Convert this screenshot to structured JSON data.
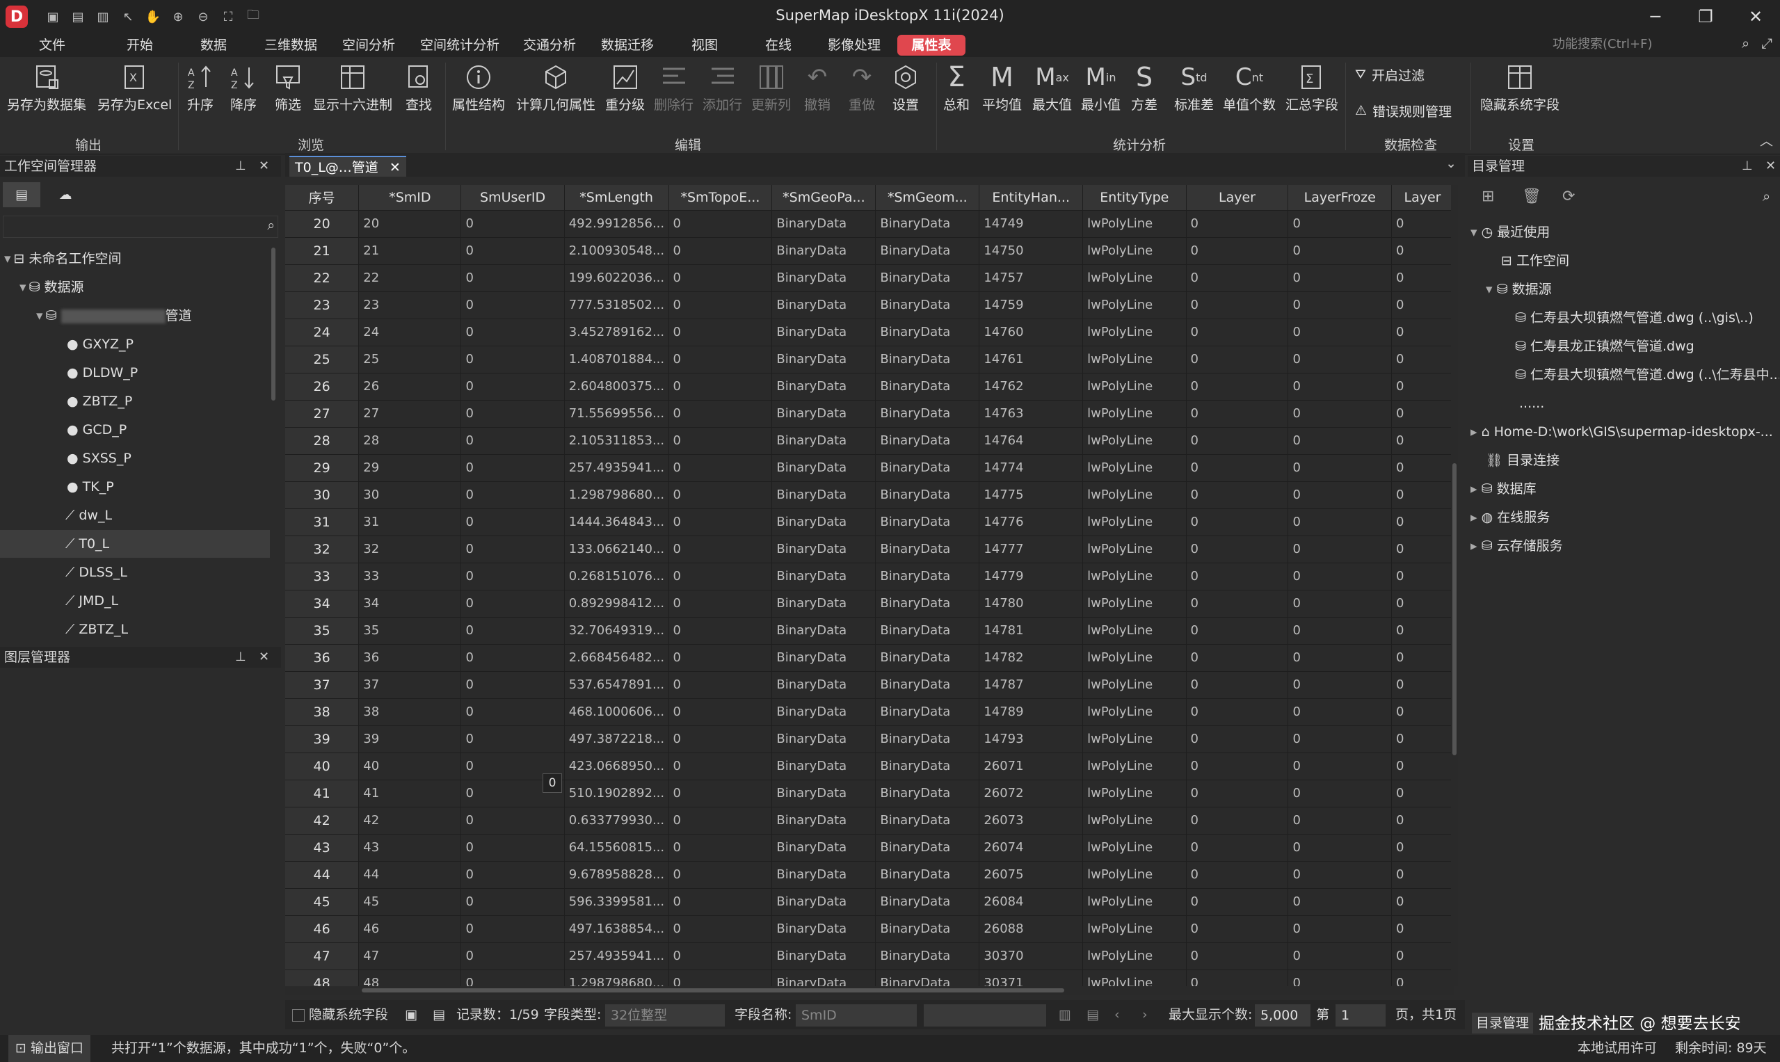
{
  "app_title": "SuperMap iDesktopX 11i(2024)",
  "menus": [
    "文件",
    "开始",
    "数据",
    "三维数据",
    "空间分析",
    "空间统计分析",
    "交通分析",
    "数据迁移",
    "视图",
    "在线",
    "影像处理",
    "属性表"
  ],
  "search_placeholder": "功能搜索(Ctrl+F)",
  "ribbon": {
    "buttons": [
      {
        "label": "另存为数据集",
        "icon": "save-as-dataset-icon"
      },
      {
        "label": "另存为Excel",
        "icon": "excel-icon"
      },
      {
        "label": "升序",
        "icon": "sort-asc-icon"
      },
      {
        "label": "降序",
        "icon": "sort-desc-icon"
      },
      {
        "label": "筛选",
        "icon": "filter-icon"
      },
      {
        "label": "显示十六进制",
        "icon": "hex-icon"
      },
      {
        "label": "查找",
        "icon": "find-icon"
      },
      {
        "label": "属性结构",
        "icon": "info-icon"
      },
      {
        "label": "计算几何属性",
        "icon": "geometry-icon"
      },
      {
        "label": "重分级",
        "icon": "reclass-icon"
      },
      {
        "label": "删除行",
        "icon": "delete-row-icon"
      },
      {
        "label": "添加行",
        "icon": "add-row-icon"
      },
      {
        "label": "更新列",
        "icon": "update-column-icon"
      },
      {
        "label": "撤销",
        "icon": "undo-icon"
      },
      {
        "label": "重做",
        "icon": "redo-icon"
      },
      {
        "label": "设置",
        "icon": "settings-icon"
      },
      {
        "label": "总和",
        "icon": "sum-icon"
      },
      {
        "label": "平均值",
        "icon": "mean-icon"
      },
      {
        "label": "最大值",
        "icon": "max-icon"
      },
      {
        "label": "最小值",
        "icon": "min-icon"
      },
      {
        "label": "方差",
        "icon": "variance-icon"
      },
      {
        "label": "标准差",
        "icon": "std-icon"
      },
      {
        "label": "单值个数",
        "icon": "count-icon"
      },
      {
        "label": "汇总字段",
        "icon": "summary-icon"
      },
      {
        "label": "隐藏系统字段",
        "icon": "hide-fields-icon"
      }
    ],
    "small_buttons": [
      "开启过滤",
      "错误规则管理"
    ],
    "groups": [
      "输出",
      "浏览",
      "编辑",
      "统计分析",
      "数据检查",
      "设置"
    ]
  },
  "workspace_panel": {
    "title": "工作空间管理器",
    "tree": [
      {
        "label": "未命名工作空间"
      },
      {
        "label": "数据源"
      },
      {
        "label": "管道"
      },
      {
        "label": "GXYZ_P"
      },
      {
        "label": "DLDW_P"
      },
      {
        "label": "ZBTZ_P"
      },
      {
        "label": "GCD_P"
      },
      {
        "label": "SXSS_P"
      },
      {
        "label": "TK_P"
      },
      {
        "label": "dw_L"
      },
      {
        "label": "T0_L"
      },
      {
        "label": "DLSS_L"
      },
      {
        "label": "JMD_L"
      },
      {
        "label": "ZBTZ_L"
      }
    ]
  },
  "layer_panel": {
    "title": "图层管理器"
  },
  "tab": {
    "label": "T0_L@…管道"
  },
  "columns": [
    "序号",
    "*SmID",
    "SmUserID",
    "*SmLength",
    "*SmTopoE...",
    "*SmGeoPa...",
    "*SmGeom...",
    "EntityHan...",
    "EntityType",
    "Layer",
    "LayerFroze",
    "Layer"
  ],
  "rows": [
    [
      "20",
      "20",
      "0",
      "492.9912856...",
      "0",
      "BinaryData",
      "BinaryData",
      "14749",
      "lwPolyLine",
      "0",
      "0",
      "0"
    ],
    [
      "21",
      "21",
      "0",
      "2.100930548...",
      "0",
      "BinaryData",
      "BinaryData",
      "14750",
      "lwPolyLine",
      "0",
      "0",
      "0"
    ],
    [
      "22",
      "22",
      "0",
      "199.6022036...",
      "0",
      "BinaryData",
      "BinaryData",
      "14757",
      "lwPolyLine",
      "0",
      "0",
      "0"
    ],
    [
      "23",
      "23",
      "0",
      "777.5318502...",
      "0",
      "BinaryData",
      "BinaryData",
      "14759",
      "lwPolyLine",
      "0",
      "0",
      "0"
    ],
    [
      "24",
      "24",
      "0",
      "3.452789162...",
      "0",
      "BinaryData",
      "BinaryData",
      "14760",
      "lwPolyLine",
      "0",
      "0",
      "0"
    ],
    [
      "25",
      "25",
      "0",
      "1.408701884...",
      "0",
      "BinaryData",
      "BinaryData",
      "14761",
      "lwPolyLine",
      "0",
      "0",
      "0"
    ],
    [
      "26",
      "26",
      "0",
      "2.604800375...",
      "0",
      "BinaryData",
      "BinaryData",
      "14762",
      "lwPolyLine",
      "0",
      "0",
      "0"
    ],
    [
      "27",
      "27",
      "0",
      "71.55699556...",
      "0",
      "BinaryData",
      "BinaryData",
      "14763",
      "lwPolyLine",
      "0",
      "0",
      "0"
    ],
    [
      "28",
      "28",
      "0",
      "2.105311853...",
      "0",
      "BinaryData",
      "BinaryData",
      "14764",
      "lwPolyLine",
      "0",
      "0",
      "0"
    ],
    [
      "29",
      "29",
      "0",
      "257.4935941...",
      "0",
      "BinaryData",
      "BinaryData",
      "14774",
      "lwPolyLine",
      "0",
      "0",
      "0"
    ],
    [
      "30",
      "30",
      "0",
      "1.298798680...",
      "0",
      "BinaryData",
      "BinaryData",
      "14775",
      "lwPolyLine",
      "0",
      "0",
      "0"
    ],
    [
      "31",
      "31",
      "0",
      "1444.364843...",
      "0",
      "BinaryData",
      "BinaryData",
      "14776",
      "lwPolyLine",
      "0",
      "0",
      "0"
    ],
    [
      "32",
      "32",
      "0",
      "133.0662140...",
      "0",
      "BinaryData",
      "BinaryData",
      "14777",
      "lwPolyLine",
      "0",
      "0",
      "0"
    ],
    [
      "33",
      "33",
      "0",
      "0.268151076...",
      "0",
      "BinaryData",
      "BinaryData",
      "14779",
      "lwPolyLine",
      "0",
      "0",
      "0"
    ],
    [
      "34",
      "34",
      "0",
      "0.892998412...",
      "0",
      "BinaryData",
      "BinaryData",
      "14780",
      "lwPolyLine",
      "0",
      "0",
      "0"
    ],
    [
      "35",
      "35",
      "0",
      "32.70649319...",
      "0",
      "BinaryData",
      "BinaryData",
      "14781",
      "lwPolyLine",
      "0",
      "0",
      "0"
    ],
    [
      "36",
      "36",
      "0",
      "2.668456482...",
      "0",
      "BinaryData",
      "BinaryData",
      "14782",
      "lwPolyLine",
      "0",
      "0",
      "0"
    ],
    [
      "37",
      "37",
      "0",
      "537.6547891...",
      "0",
      "BinaryData",
      "BinaryData",
      "14787",
      "lwPolyLine",
      "0",
      "0",
      "0"
    ],
    [
      "38",
      "38",
      "0",
      "468.1000606...",
      "0",
      "BinaryData",
      "BinaryData",
      "14789",
      "lwPolyLine",
      "0",
      "0",
      "0"
    ],
    [
      "39",
      "39",
      "0",
      "497.3872218...",
      "0",
      "BinaryData",
      "BinaryData",
      "14793",
      "lwPolyLine",
      "0",
      "0",
      "0"
    ],
    [
      "40",
      "40",
      "0",
      "423.0668950...",
      "0",
      "BinaryData",
      "BinaryData",
      "26071",
      "lwPolyLine",
      "0",
      "0",
      "0"
    ],
    [
      "41",
      "41",
      "0",
      "510.1902892...",
      "0",
      "BinaryData",
      "BinaryData",
      "26072",
      "lwPolyLine",
      "0",
      "0",
      "0"
    ],
    [
      "42",
      "42",
      "0",
      "0.633779930...",
      "0",
      "BinaryData",
      "BinaryData",
      "26073",
      "lwPolyLine",
      "0",
      "0",
      "0"
    ],
    [
      "43",
      "43",
      "0",
      "64.15560815...",
      "0",
      "BinaryData",
      "BinaryData",
      "26074",
      "lwPolyLine",
      "0",
      "0",
      "0"
    ],
    [
      "44",
      "44",
      "0",
      "9.678958828...",
      "0",
      "BinaryData",
      "BinaryData",
      "26075",
      "lwPolyLine",
      "0",
      "0",
      "0"
    ],
    [
      "45",
      "45",
      "0",
      "596.3399581...",
      "0",
      "BinaryData",
      "BinaryData",
      "26084",
      "lwPolyLine",
      "0",
      "0",
      "0"
    ],
    [
      "46",
      "46",
      "0",
      "497.1638854...",
      "0",
      "BinaryData",
      "BinaryData",
      "26088",
      "lwPolyLine",
      "0",
      "0",
      "0"
    ],
    [
      "47",
      "47",
      "0",
      "257.4935941...",
      "0",
      "BinaryData",
      "BinaryData",
      "30370",
      "lwPolyLine",
      "0",
      "0",
      "0"
    ],
    [
      "48",
      "48",
      "0",
      "1.298798680...",
      "0",
      "BinaryData",
      "BinaryData",
      "30371",
      "lwPolyLine",
      "0",
      "0",
      "0"
    ]
  ],
  "cell_tooltip": "0",
  "grid_status": {
    "hide_system_fields": "隐藏系统字段",
    "record_count": "记录数：1/59",
    "field_type_label": "字段类型:",
    "field_type_value": "32位整型",
    "field_name_label": "字段名称:",
    "field_name_value": "SmID",
    "max_display_label": "最大显示个数:",
    "max_display_value": "5,000",
    "page_prefix": "第",
    "page_value": "1",
    "page_suffix": "页，共1页"
  },
  "catalog_panel": {
    "title": "目录管理",
    "tree": [
      {
        "label": "最近使用"
      },
      {
        "label": "工作空间"
      },
      {
        "label": "数据源"
      },
      {
        "label": "仁寿县大坝镇燃气管道.dwg (..\\gis\\..)"
      },
      {
        "label": "仁寿县龙正镇燃气管道.dwg"
      },
      {
        "label": "仁寿县大坝镇燃气管道.dwg (..\\仁寿县中..."
      },
      {
        "label": "......"
      },
      {
        "label": "Home-D:\\work\\GIS\\supermap-idesktopx-..."
      },
      {
        "label": "目录连接"
      },
      {
        "label": "数据库"
      },
      {
        "label": "在线服务"
      },
      {
        "label": "云存储服务"
      }
    ],
    "footer_tab": "目录管理",
    "watermark": "掘金技术社区 @ 想要去长安"
  },
  "bottom": {
    "output_window": "输出窗口",
    "message": "共打开“1”个数据源，其中成功“1”个，失败“0”个。",
    "license": "本地试用许可",
    "remaining": "剩余时间: 89天"
  },
  "colors": {
    "accent": "#e0474e",
    "bg": "#2b2b2b"
  }
}
